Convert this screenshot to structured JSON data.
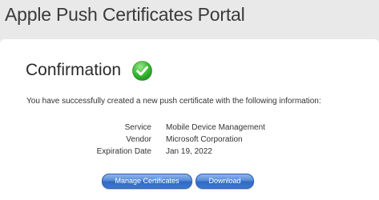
{
  "header": {
    "title": "Apple Push Certificates Portal"
  },
  "confirmation": {
    "heading": "Confirmation",
    "message": "You have successfully created a new push certificate with the following information:",
    "details": [
      {
        "label": "Service",
        "value": "Mobile Device Management"
      },
      {
        "label": "Vendor",
        "value": "Microsoft Corporation"
      },
      {
        "label": "Expiration Date",
        "value": "Jan 19, 2022"
      }
    ]
  },
  "actions": {
    "manage_label": "Manage Certificates",
    "download_label": "Download"
  },
  "colors": {
    "success_green": "#2db52d",
    "button_blue": "#3c78d4",
    "page_background": "#e9e9e9"
  },
  "icons": {
    "status": "check-circle-icon"
  }
}
